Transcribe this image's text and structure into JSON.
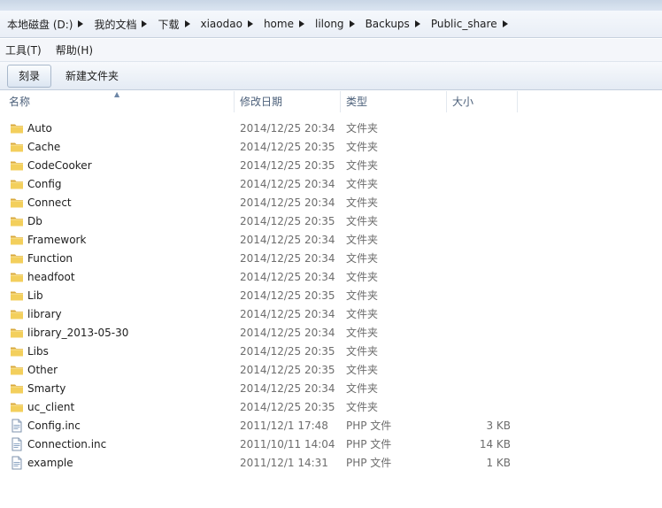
{
  "breadcrumb": [
    "本地磁盘 (D:)",
    "我的文档",
    "下载",
    "xiaodao",
    "home",
    "lilong",
    "Backups",
    "Public_share"
  ],
  "menu": [
    "工具(T)",
    "帮助(H)"
  ],
  "toolbar": {
    "burn": "刻录",
    "new_folder": "新建文件夹"
  },
  "columns": {
    "name": "名称",
    "date": "修改日期",
    "type": "类型",
    "size": "大小"
  },
  "files": [
    {
      "name": "Auto",
      "date": "2014/12/25 20:34",
      "type": "文件夹",
      "size": "",
      "icon": "folder-icon"
    },
    {
      "name": "Cache",
      "date": "2014/12/25 20:35",
      "type": "文件夹",
      "size": "",
      "icon": "folder-icon"
    },
    {
      "name": "CodeCooker",
      "date": "2014/12/25 20:35",
      "type": "文件夹",
      "size": "",
      "icon": "folder-icon"
    },
    {
      "name": "Config",
      "date": "2014/12/25 20:34",
      "type": "文件夹",
      "size": "",
      "icon": "folder-icon"
    },
    {
      "name": "Connect",
      "date": "2014/12/25 20:34",
      "type": "文件夹",
      "size": "",
      "icon": "folder-icon"
    },
    {
      "name": "Db",
      "date": "2014/12/25 20:35",
      "type": "文件夹",
      "size": "",
      "icon": "folder-icon"
    },
    {
      "name": "Framework",
      "date": "2014/12/25 20:34",
      "type": "文件夹",
      "size": "",
      "icon": "folder-icon"
    },
    {
      "name": "Function",
      "date": "2014/12/25 20:34",
      "type": "文件夹",
      "size": "",
      "icon": "folder-icon"
    },
    {
      "name": "headfoot",
      "date": "2014/12/25 20:34",
      "type": "文件夹",
      "size": "",
      "icon": "folder-icon"
    },
    {
      "name": "Lib",
      "date": "2014/12/25 20:35",
      "type": "文件夹",
      "size": "",
      "icon": "folder-icon"
    },
    {
      "name": "library",
      "date": "2014/12/25 20:34",
      "type": "文件夹",
      "size": "",
      "icon": "folder-icon"
    },
    {
      "name": "library_2013-05-30",
      "date": "2014/12/25 20:34",
      "type": "文件夹",
      "size": "",
      "icon": "folder-icon"
    },
    {
      "name": "Libs",
      "date": "2014/12/25 20:35",
      "type": "文件夹",
      "size": "",
      "icon": "folder-icon"
    },
    {
      "name": "Other",
      "date": "2014/12/25 20:35",
      "type": "文件夹",
      "size": "",
      "icon": "folder-icon"
    },
    {
      "name": "Smarty",
      "date": "2014/12/25 20:34",
      "type": "文件夹",
      "size": "",
      "icon": "folder-icon"
    },
    {
      "name": "uc_client",
      "date": "2014/12/25 20:35",
      "type": "文件夹",
      "size": "",
      "icon": "folder-icon"
    },
    {
      "name": "Config.inc",
      "date": "2011/12/1 17:48",
      "type": "PHP 文件",
      "size": "3 KB",
      "icon": "php-file-icon"
    },
    {
      "name": "Connection.inc",
      "date": "2011/10/11 14:04",
      "type": "PHP 文件",
      "size": "14 KB",
      "icon": "php-file-icon"
    },
    {
      "name": "example",
      "date": "2011/12/1 14:31",
      "type": "PHP 文件",
      "size": "1 KB",
      "icon": "php-file-icon"
    }
  ]
}
